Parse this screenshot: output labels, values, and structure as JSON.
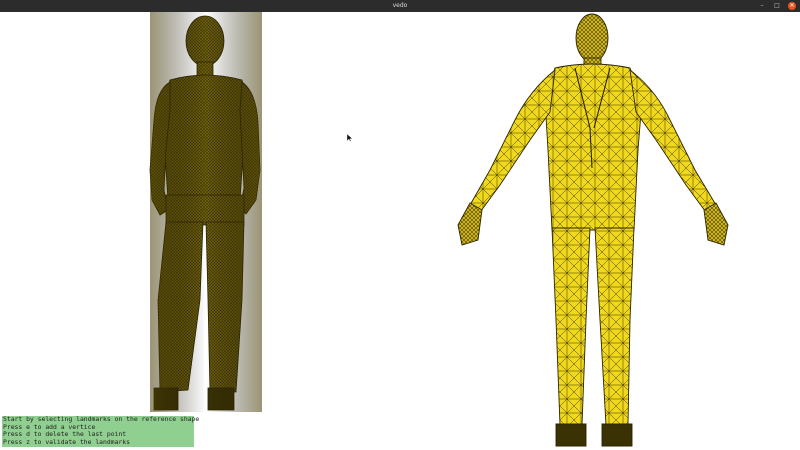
{
  "window": {
    "title": "vedo",
    "minimize_symbol": "–",
    "maximize_symbol": "□",
    "close_symbol": "✕"
  },
  "colors": {
    "titlebar": "#2c2c2c",
    "close_button": "#e95420",
    "mesh_fill_bright": "#f2dc1e",
    "mesh_fill_dark": "#7a6a12",
    "wireframe": "#2b2400",
    "instruction_panel": "#8fcf8f"
  },
  "left_view": {
    "object": "scanned-woman-mesh",
    "icon": "woman-mesh-icon"
  },
  "right_view": {
    "object": "reference-man-in-suit-mesh",
    "icon": "man-mesh-icon"
  },
  "instructions": [
    "Start by selecting landmarks on the reference shape",
    "Press e to add a vertice",
    "Press d to delete the last point",
    "Press z to validate the landmarks"
  ],
  "cursor": "arrow-pointer-icon"
}
